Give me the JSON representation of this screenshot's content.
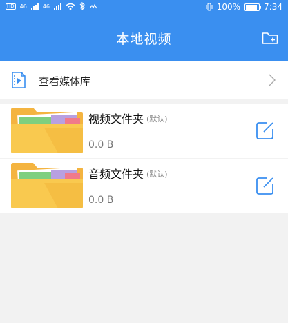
{
  "status_bar": {
    "sim1": "HD",
    "sim2": "HD",
    "net1": "46",
    "net2": "46",
    "battery_percent_text": "100%",
    "battery_level": 1.0,
    "time": "7:34"
  },
  "header": {
    "title": "本地视频",
    "bg_color": "#3a8ff0"
  },
  "library_row": {
    "label": "查看媒体库"
  },
  "folders": [
    {
      "name": "视频文件夹",
      "tag": "(默认)",
      "size": "0.0 B"
    },
    {
      "name": "音频文件夹",
      "tag": "(默认)",
      "size": "0.0 B"
    }
  ],
  "icons": {
    "add_folder": "add-folder-icon",
    "library": "media-library-icon",
    "chevron": "chevron-right-icon",
    "folder": "folder-icon",
    "edit": "edit-icon"
  },
  "accent_color": "#3a8ff0"
}
